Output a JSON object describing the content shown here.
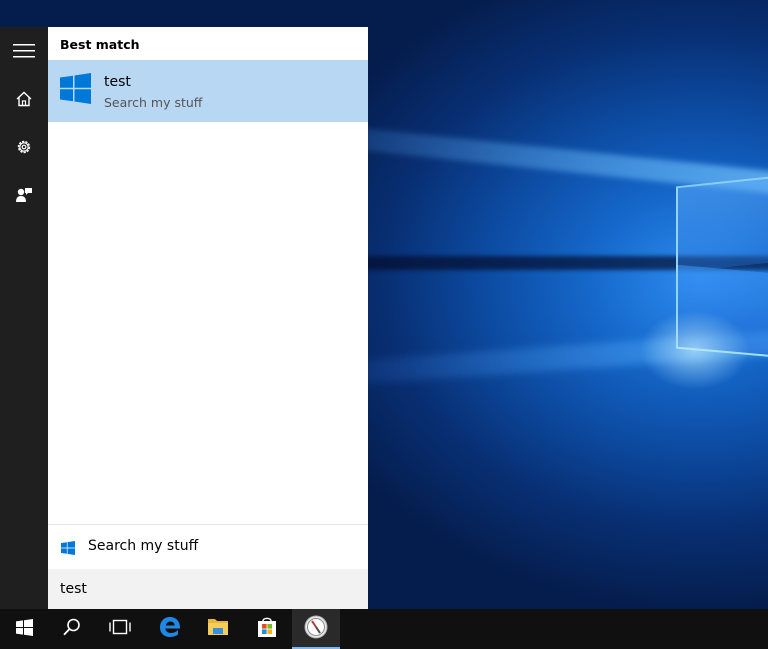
{
  "search_panel": {
    "section_header": "Best match",
    "best_match": {
      "title": "test",
      "subtitle": "Search my stuff",
      "icon": "windows-logo-icon"
    },
    "search_my_stuff": {
      "label": "Search my stuff",
      "icon": "windows-logo-icon"
    },
    "search_box": {
      "value": "test"
    }
  },
  "start_rail": {
    "items": [
      {
        "icon": "hamburger-menu-icon"
      },
      {
        "icon": "home-icon"
      },
      {
        "icon": "gear-icon"
      },
      {
        "icon": "feedback-icon"
      }
    ]
  },
  "taskbar": {
    "items": [
      {
        "icon": "start-windows-icon"
      },
      {
        "icon": "search-icon"
      },
      {
        "icon": "task-view-icon"
      },
      {
        "icon": "edge-browser-icon"
      },
      {
        "icon": "file-explorer-icon"
      },
      {
        "icon": "store-icon"
      },
      {
        "icon": "compass-app-icon",
        "active": true
      }
    ]
  },
  "colors": {
    "selection": "#b8d7f2",
    "windows_blue": "#0078d7",
    "rail_bg": "#1f1f1f",
    "taskbar_bg": "#101010"
  }
}
